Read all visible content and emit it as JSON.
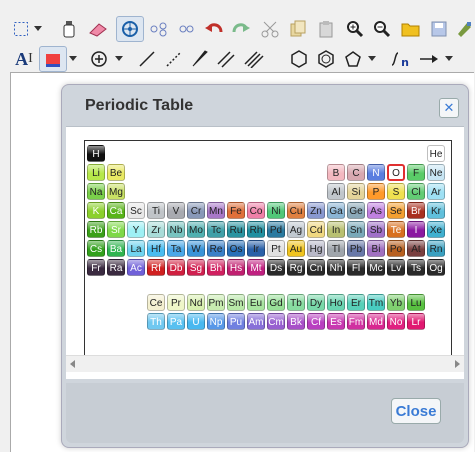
{
  "dialog": {
    "title": "Periodic Table",
    "close_icon": "✕",
    "close_button": "Close"
  },
  "colors": {
    "dialog_bg": "#cfd5dc",
    "accent": "#3a7bd5"
  },
  "periodic_table": {
    "main": [
      [
        "H",
        "",
        "",
        "",
        "",
        "",
        "",
        "",
        "",
        "",
        "",
        "",
        "",
        "",
        "",
        "",
        "",
        "He"
      ],
      [
        "Li",
        "Be",
        "",
        "",
        "",
        "",
        "",
        "",
        "",
        "",
        "",
        "",
        "B",
        "C",
        "N",
        "O",
        "F",
        "Ne"
      ],
      [
        "Na",
        "Mg",
        "",
        "",
        "",
        "",
        "",
        "",
        "",
        "",
        "",
        "",
        "Al",
        "Si",
        "P",
        "S",
        "Cl",
        "Ar"
      ],
      [
        "K",
        "Ca",
        "Sc",
        "Ti",
        "V",
        "Cr",
        "Mn",
        "Fe",
        "Co",
        "Ni",
        "Cu",
        "Zn",
        "Ga",
        "Ge",
        "As",
        "Se",
        "Br",
        "Kr"
      ],
      [
        "Rb",
        "Sr",
        "Y",
        "Zr",
        "Nb",
        "Mo",
        "Tc",
        "Ru",
        "Rh",
        "Pd",
        "Ag",
        "Cd",
        "In",
        "Sn",
        "Sb",
        "Te",
        "I",
        "Xe"
      ],
      [
        "Cs",
        "Ba",
        "La",
        "Hf",
        "Ta",
        "W",
        "Re",
        "Os",
        "Ir",
        "Pt",
        "Au",
        "Hg",
        "Tl",
        "Pb",
        "Bi",
        "Po",
        "At",
        "Rn"
      ],
      [
        "Fr",
        "Ra",
        "Ac",
        "Rf",
        "Db",
        "Sg",
        "Bh",
        "Hs",
        "Mt",
        "Ds",
        "Rg",
        "Cn",
        "Nh",
        "Fl",
        "Mc",
        "Lv",
        "Ts",
        "Og"
      ]
    ],
    "lanthanides": [
      "Ce",
      "Pr",
      "Nd",
      "Pm",
      "Sm",
      "Eu",
      "Gd",
      "Tb",
      "Dy",
      "Ho",
      "Er",
      "Tm",
      "Yb",
      "Lu"
    ],
    "actinides": [
      "Th",
      "Pa",
      "U",
      "Np",
      "Pu",
      "Am",
      "Cm",
      "Bk",
      "Cf",
      "Es",
      "Fm",
      "Md",
      "No",
      "Lr"
    ],
    "selected": "O"
  },
  "toolbar_icons_row1": [
    "select-box-icon",
    "dropdown-icon",
    "bottle-icon",
    "eraser-icon",
    "atom-icon",
    "molecule-icon",
    "molecule-alt-icon",
    "undo-icon",
    "redo-icon",
    "scissors-icon",
    "copy-icon",
    "paste-icon",
    "zoom-in-icon",
    "zoom-out-icon",
    "folder-open-icon",
    "save-icon",
    "paint-icon"
  ],
  "toolbar_icons_row2": [
    "text-icon",
    "color-icon",
    "dropdown-icon",
    "plus-circle-icon",
    "dropdown-icon",
    "line-icon",
    "dashed-line-icon",
    "bold-line-icon",
    "double-line-icon",
    "triple-line-icon",
    "hexagon-icon",
    "benzene-icon",
    "pentagon-icon",
    "dropdown-icon",
    "sn-icon",
    "arrow-icon",
    "dropdown-icon"
  ],
  "toolbar_text": {
    "text_tool": "A",
    "sn_label": "n"
  }
}
